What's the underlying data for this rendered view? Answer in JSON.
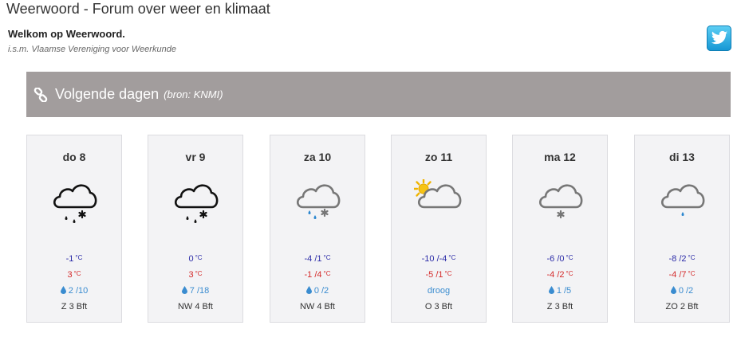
{
  "header": {
    "site_title": "Weerwoord - Forum over weer en klimaat",
    "welcome": "Welkom op Weerwoord.",
    "subtitle": "i.s.m. Vlaamse Vereniging voor Weerkunde",
    "twitter_icon": "twitter-icon"
  },
  "banner": {
    "title": "Volgende dagen",
    "source": "(bron: KNMI)",
    "icon": "link-icon",
    "background": "#a29d9d"
  },
  "colors": {
    "min_temp": "#2c2ca8",
    "max_temp": "#d42a2a",
    "precip": "#3a8cd0",
    "card_bg": "#f3f3f5"
  },
  "temp_unit": "°C",
  "days": [
    {
      "label": "do 8",
      "icon": "dark-cloud-rain-snow-icon",
      "min": "-1",
      "max": "3",
      "precip": "2 /10",
      "wind": "Z 3 Bft"
    },
    {
      "label": "vr 9",
      "icon": "dark-cloud-rain-snow-icon",
      "min": "0",
      "max": "3",
      "precip": "7 /18",
      "wind": "NW 4 Bft"
    },
    {
      "label": "za 10",
      "icon": "cloud-rain-snow-icon",
      "min": "-4 /1",
      "max": "-1 /4",
      "precip": "0 /2",
      "wind": "NW 4 Bft"
    },
    {
      "label": "zo 11",
      "icon": "sun-cloud-icon",
      "min": "-10 /-4",
      "max": "-5 /1",
      "precip": "droog",
      "wind": "O 3 Bft"
    },
    {
      "label": "ma 12",
      "icon": "cloud-snow-icon",
      "min": "-6 /0",
      "max": "-4 /2",
      "precip": "1 /5",
      "wind": "Z 3 Bft"
    },
    {
      "label": "di 13",
      "icon": "cloud-rain-icon",
      "min": "-8 /2",
      "max": "-4 /7",
      "precip": "0 /2",
      "wind": "ZO 2 Bft"
    }
  ]
}
